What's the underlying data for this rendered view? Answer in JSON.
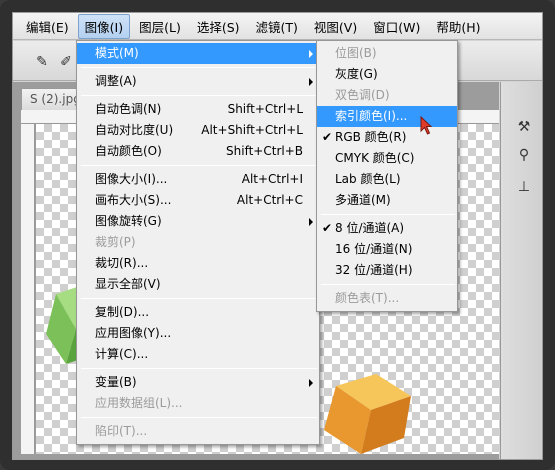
{
  "menubar": {
    "items": [
      "编辑(E)",
      "图像(I)",
      "图层(L)",
      "选择(S)",
      "滤镜(T)",
      "视图(V)",
      "窗口(W)",
      "帮助(H)"
    ],
    "active_index": 1
  },
  "document": {
    "tab_title": "S (2).jpg"
  },
  "image_menu": {
    "items": [
      {
        "label": "模式(M)",
        "shortcut": "",
        "submenu": true,
        "highlighted": true
      },
      {
        "sep": true
      },
      {
        "label": "调整(A)",
        "shortcut": "",
        "submenu": true
      },
      {
        "sep": true
      },
      {
        "label": "自动色调(N)",
        "shortcut": "Shift+Ctrl+L"
      },
      {
        "label": "自动对比度(U)",
        "shortcut": "Alt+Shift+Ctrl+L"
      },
      {
        "label": "自动颜色(O)",
        "shortcut": "Shift+Ctrl+B"
      },
      {
        "sep": true
      },
      {
        "label": "图像大小(I)...",
        "shortcut": "Alt+Ctrl+I"
      },
      {
        "label": "画布大小(S)...",
        "shortcut": "Alt+Ctrl+C"
      },
      {
        "label": "图像旋转(G)",
        "shortcut": "",
        "submenu": true
      },
      {
        "label": "裁剪(P)",
        "shortcut": "",
        "disabled": true
      },
      {
        "label": "裁切(R)...",
        "shortcut": ""
      },
      {
        "label": "显示全部(V)",
        "shortcut": ""
      },
      {
        "sep": true
      },
      {
        "label": "复制(D)...",
        "shortcut": ""
      },
      {
        "label": "应用图像(Y)...",
        "shortcut": ""
      },
      {
        "label": "计算(C)...",
        "shortcut": ""
      },
      {
        "sep": true
      },
      {
        "label": "变量(B)",
        "shortcut": "",
        "submenu": true
      },
      {
        "label": "应用数据组(L)...",
        "shortcut": "",
        "disabled": true
      },
      {
        "sep": true
      },
      {
        "label": "陷印(T)...",
        "shortcut": "",
        "disabled": true
      }
    ]
  },
  "mode_submenu": {
    "items": [
      {
        "label": "位图(B)",
        "disabled": true
      },
      {
        "label": "灰度(G)"
      },
      {
        "label": "双色调(D)",
        "disabled": true
      },
      {
        "label": "索引颜色(I)...",
        "highlighted": true
      },
      {
        "label": "RGB 颜色(R)",
        "checked": true
      },
      {
        "label": "CMYK 颜色(C)"
      },
      {
        "label": "Lab 颜色(L)"
      },
      {
        "label": "多通道(M)"
      },
      {
        "sep": true
      },
      {
        "label": "8 位/通道(A)",
        "checked": true
      },
      {
        "label": "16 位/通道(N)"
      },
      {
        "label": "32 位/通道(H)"
      },
      {
        "sep": true
      },
      {
        "label": "颜色表(T)...",
        "disabled": true
      }
    ]
  },
  "colors": {
    "highlight": "#3399ff",
    "cube_orange": "#f2a23a",
    "cube_green": "#8fcf6a"
  }
}
